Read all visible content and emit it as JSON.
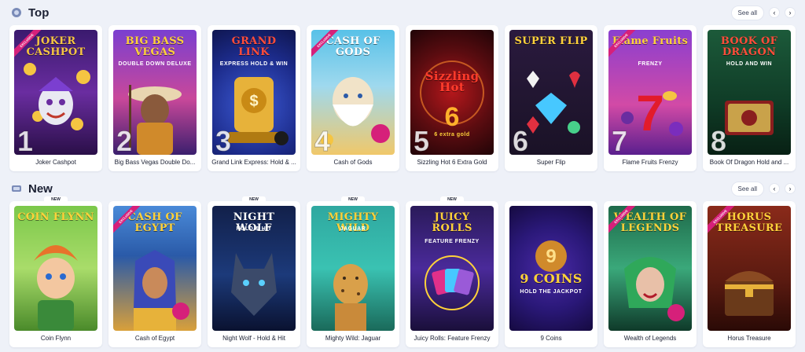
{
  "sections": {
    "top": {
      "title": "Top",
      "see_all": "See all",
      "prev_icon": "chevron-left-icon",
      "next_icon": "chevron-right-icon",
      "games": [
        {
          "label": "Joker Cashpot",
          "art_title": "JOKER CASHPOT",
          "rank": "1",
          "ribbon": "EXCLUSIVE"
        },
        {
          "label": "Big Bass Vegas Double Do...",
          "art_title": "BIG BASS VEGAS",
          "art_sub": "DOUBLE DOWN DELUXE",
          "rank": "2"
        },
        {
          "label": "Grand Link Express: Hold & ...",
          "art_title": "GRAND LINK",
          "art_sub": "EXPRESS HOLD & WIN",
          "rank": "3"
        },
        {
          "label": "Cash of Gods",
          "art_title": "CASH OF GODS",
          "rank": "4",
          "ribbon": "EXCLUSIVE"
        },
        {
          "label": "Sizzling Hot 6 Extra Gold",
          "art_title": "Sizzling Hot",
          "art_sub": "6 extra gold",
          "rank": "5"
        },
        {
          "label": "Super Flip",
          "art_title": "SUPER FLIP",
          "rank": "6"
        },
        {
          "label": "Flame Fruits Frenzy",
          "art_title": "Flame Fruits",
          "art_sub": "FRENZY",
          "rank": "7",
          "ribbon": "EXCLUSIVE"
        },
        {
          "label": "Book Of Dragon Hold and ...",
          "art_title": "BOOK OF DRAGON",
          "art_sub": "HOLD AND WIN",
          "rank": "8"
        }
      ]
    },
    "new": {
      "title": "New",
      "see_all": "See all",
      "prev_icon": "chevron-left-icon",
      "next_icon": "chevron-right-icon",
      "games": [
        {
          "label": "Coin Flynn",
          "art_title": "COIN FLYNN",
          "badge": "NEW"
        },
        {
          "label": "Cash of Egypt",
          "art_title": "CASH OF EGYPT",
          "ribbon": "EXCLUSIVE"
        },
        {
          "label": "Night Wolf - Hold & Hit",
          "art_title": "NIGHT WOLF",
          "art_sub": "HOLD & HIT",
          "badge": "NEW"
        },
        {
          "label": "Mighty Wild: Jaguar",
          "art_title": "MIGHTY WILD",
          "art_sub": "JAGUAR",
          "badge": "NEW"
        },
        {
          "label": "Juicy Rolls: Feature Frenzy",
          "art_title": "JUICY ROLLS",
          "art_sub": "FEATURE FRENZY",
          "badge": "NEW"
        },
        {
          "label": "9 Coins",
          "art_title": "9 COINS",
          "art_sub": "HOLD THE JACKPOT"
        },
        {
          "label": "Wealth of Legends",
          "art_title": "WEALTH OF LEGENDS",
          "ribbon": "EXCLUSIVE"
        },
        {
          "label": "Horus Treasure",
          "art_title": "HORUS TREASURE",
          "ribbon": "EXCLUSIVE"
        }
      ]
    }
  },
  "colors": {
    "page_bg": "#eef1f8",
    "card_bg": "#ffffff",
    "text": "#1b2033",
    "ribbon": "#d6207a"
  }
}
